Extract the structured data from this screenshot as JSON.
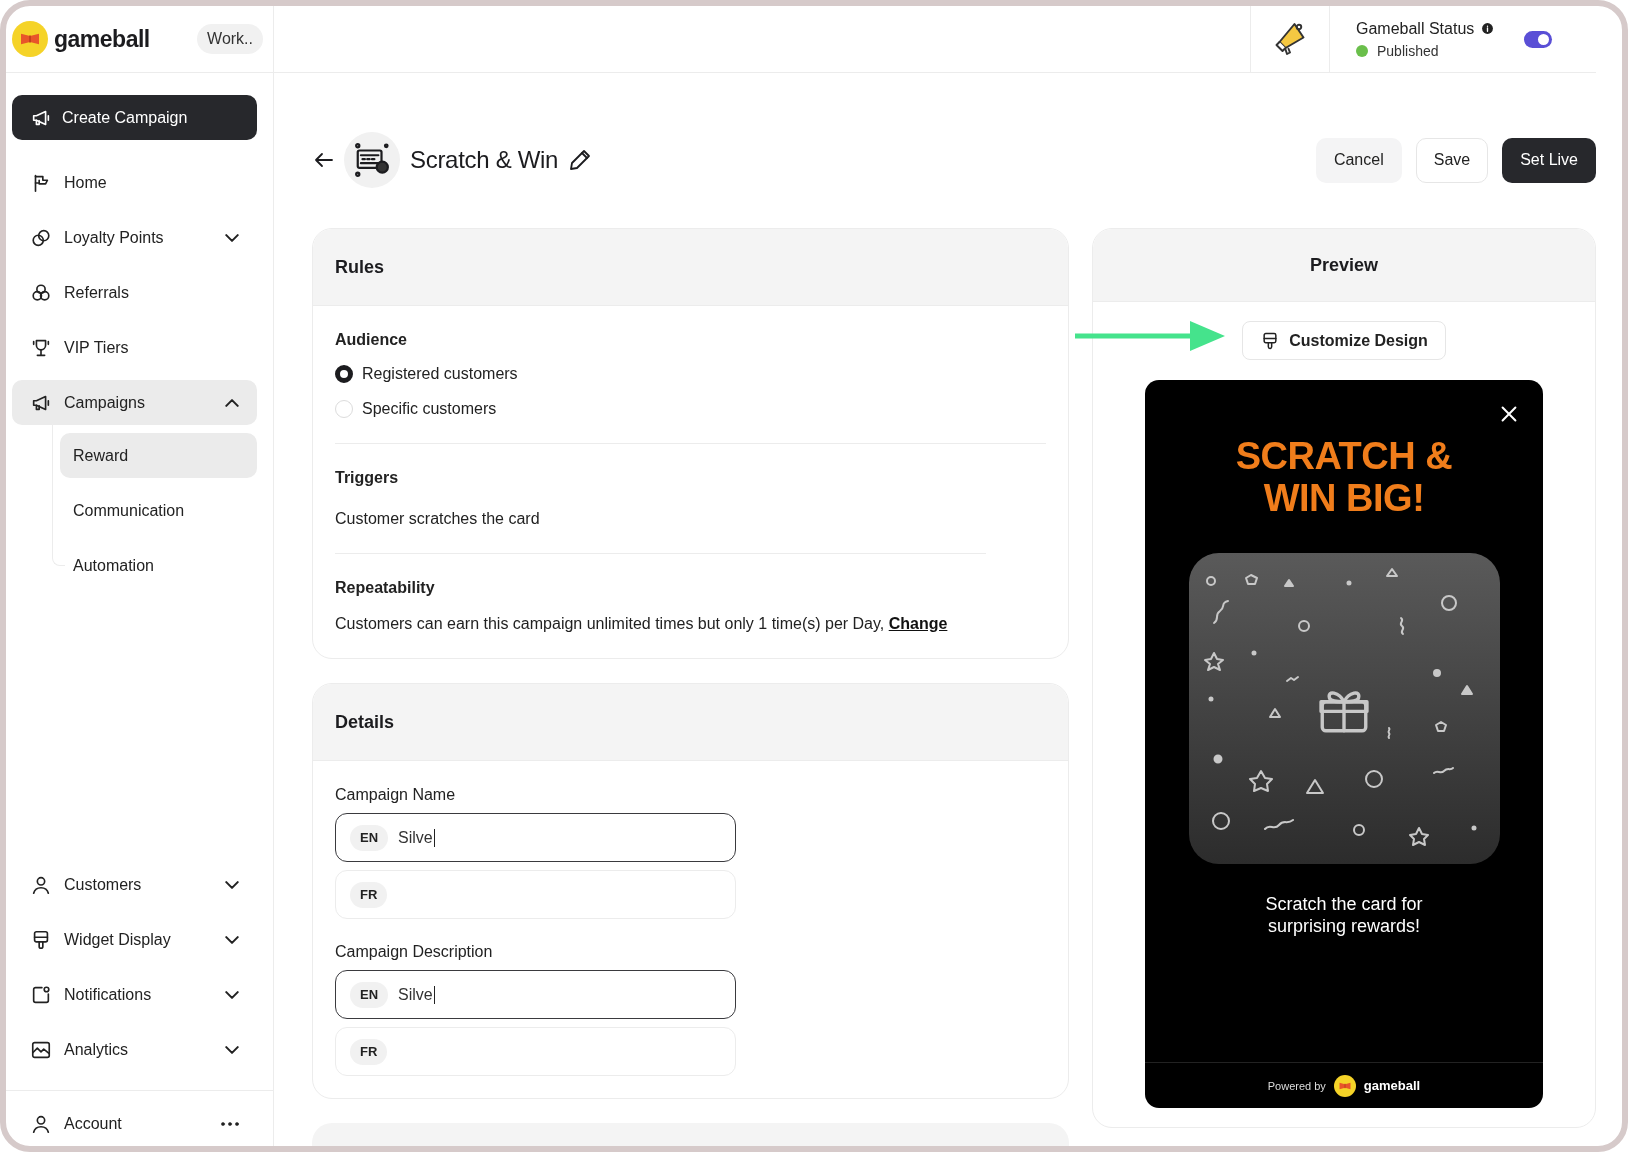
{
  "sidebar": {
    "brand": "gameball",
    "workspace": "Work..",
    "create_button": "Create Campaign",
    "items": [
      {
        "label": "Home",
        "kind": "link",
        "selected": false
      },
      {
        "label": "Loyalty Points",
        "kind": "group",
        "selected": false,
        "expanded": false
      },
      {
        "label": "Referrals",
        "kind": "link",
        "selected": false
      },
      {
        "label": "VIP Tiers",
        "kind": "link",
        "selected": false
      },
      {
        "label": "Campaigns",
        "kind": "group",
        "selected": true,
        "expanded": true,
        "children": [
          {
            "label": "Reward",
            "selected": true
          },
          {
            "label": "Communication",
            "selected": false
          },
          {
            "label": "Automation",
            "selected": false
          }
        ]
      }
    ],
    "bottom_items": [
      {
        "label": "Customers",
        "kind": "group",
        "selected": false,
        "expanded": false
      },
      {
        "label": "Widget Display",
        "kind": "group",
        "selected": false,
        "expanded": false
      },
      {
        "label": "Notifications",
        "kind": "group",
        "selected": false,
        "expanded": false
      },
      {
        "label": "Analytics",
        "kind": "group",
        "selected": false,
        "expanded": false
      }
    ],
    "account": {
      "label": "Account"
    }
  },
  "top_bar": {
    "status_label": "Gameball Status",
    "status": "Published",
    "live": true
  },
  "header": {
    "title": "Scratch & Win",
    "buttons": [
      {
        "label": "Cancel",
        "kind": "secondary"
      },
      {
        "label": "Save",
        "kind": "outline"
      },
      {
        "label": "Set Live",
        "kind": "primary"
      }
    ]
  },
  "rules": {
    "title": "Rules",
    "sections": [
      {
        "heading": "Audience",
        "kind": "radio",
        "options": [
          {
            "label": "Registered customers",
            "selected": true
          },
          {
            "label": "Specific customers",
            "selected": false
          }
        ]
      },
      {
        "heading": "Triggers",
        "kind": "text",
        "text": "Customer scratches the card"
      },
      {
        "heading": "Repeatability",
        "kind": "text_link",
        "text": "Customers can earn this campaign unlimited times but only 1 time(s) per Day,",
        "link": "Change"
      }
    ]
  },
  "details": {
    "title": "Details",
    "fields": [
      {
        "label": "Campaign Name",
        "inputs": [
          {
            "lang": "EN",
            "value": "Silve",
            "focused": true
          },
          {
            "lang": "FR",
            "focused": false
          }
        ]
      },
      {
        "label": "Campaign Description",
        "inputs": [
          {
            "lang": "EN",
            "value": "Silve",
            "focused": true
          },
          {
            "lang": "FR",
            "focused": false
          }
        ]
      }
    ]
  },
  "preview": {
    "title": "Preview",
    "customize_button": "Customize Design",
    "popup": {
      "heading": "SCRATCH & WIN BIG!",
      "message": "Scratch the card for surprising rewards!",
      "powered_by": "Powered by",
      "brand": "gameball"
    }
  }
}
